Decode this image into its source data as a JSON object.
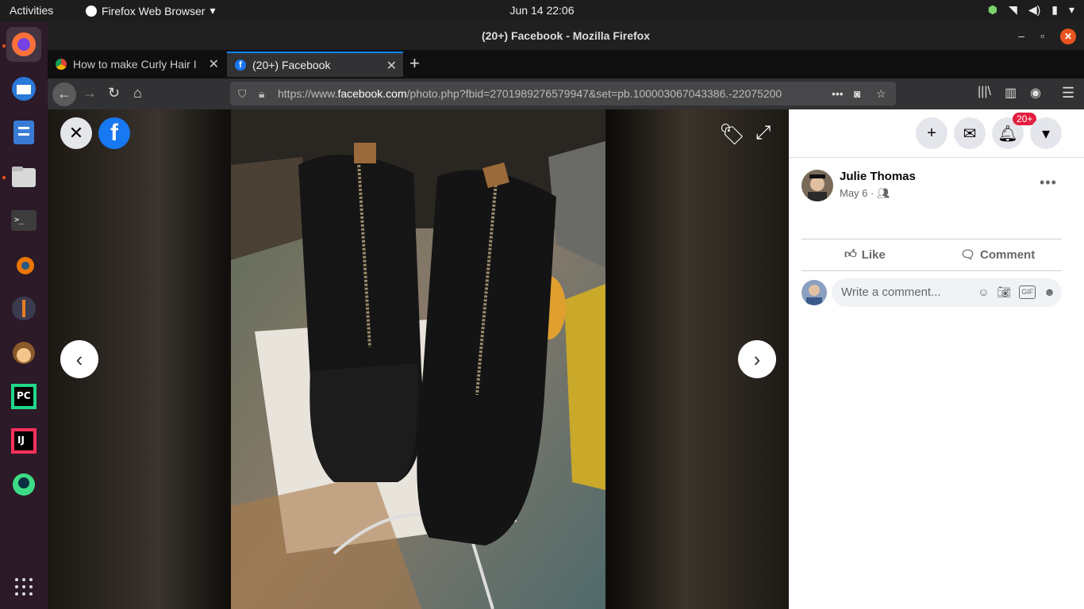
{
  "system": {
    "activities": "Activities",
    "app_name": "Firefox Web Browser",
    "datetime": "Jun 14  22:06"
  },
  "window": {
    "title": "(20+) Facebook - Mozilla Firefox"
  },
  "tabs": [
    {
      "label": "How to make Curly Hair I"
    },
    {
      "label": "(20+) Facebook"
    }
  ],
  "urlbar": {
    "prefix": "https://www.",
    "domain": "facebook.com",
    "path": "/photo.php?fbid=2701989276579947&set=pb.100003067043386.-22075200"
  },
  "facebook": {
    "notification_count": "20+",
    "post": {
      "author": "Julie Thomas",
      "date": "May 6 ·"
    },
    "actions": {
      "like": "Like",
      "comment": "Comment"
    },
    "comment_placeholder": "Write a comment..."
  },
  "icons": {
    "close": "close-icon",
    "tag": "tag-icon",
    "expand": "fullscreen-icon",
    "prev": "chevron-left-icon",
    "next": "chevron-right-icon"
  }
}
